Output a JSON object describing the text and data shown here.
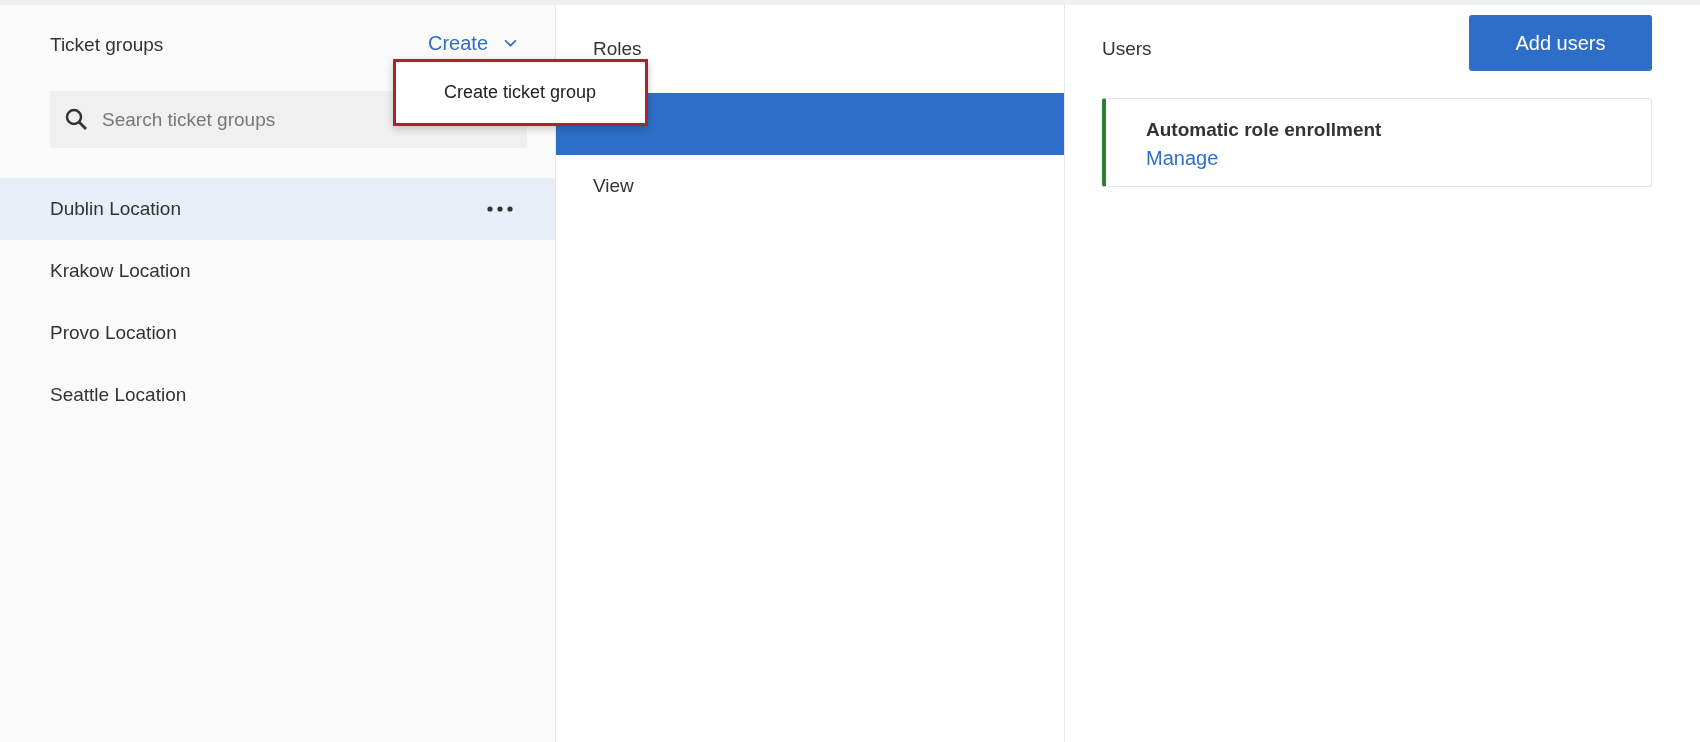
{
  "ticket_groups": {
    "title": "Ticket groups",
    "create_button": "Create",
    "create_menu": {
      "items": [
        "Create ticket group"
      ]
    },
    "search": {
      "placeholder": "Search ticket groups"
    },
    "items": [
      {
        "label": "Dublin Location",
        "selected": true
      },
      {
        "label": "Krakow Location",
        "selected": false
      },
      {
        "label": "Provo Location",
        "selected": false
      },
      {
        "label": "Seattle Location",
        "selected": false
      }
    ]
  },
  "roles": {
    "title": "Roles",
    "items": [
      {
        "selected": true
      },
      {
        "label": "View",
        "selected": false
      }
    ]
  },
  "users": {
    "title": "Users",
    "add_button": "Add users",
    "card": {
      "title": "Automatic role enrollment",
      "link": "Manage"
    }
  }
}
